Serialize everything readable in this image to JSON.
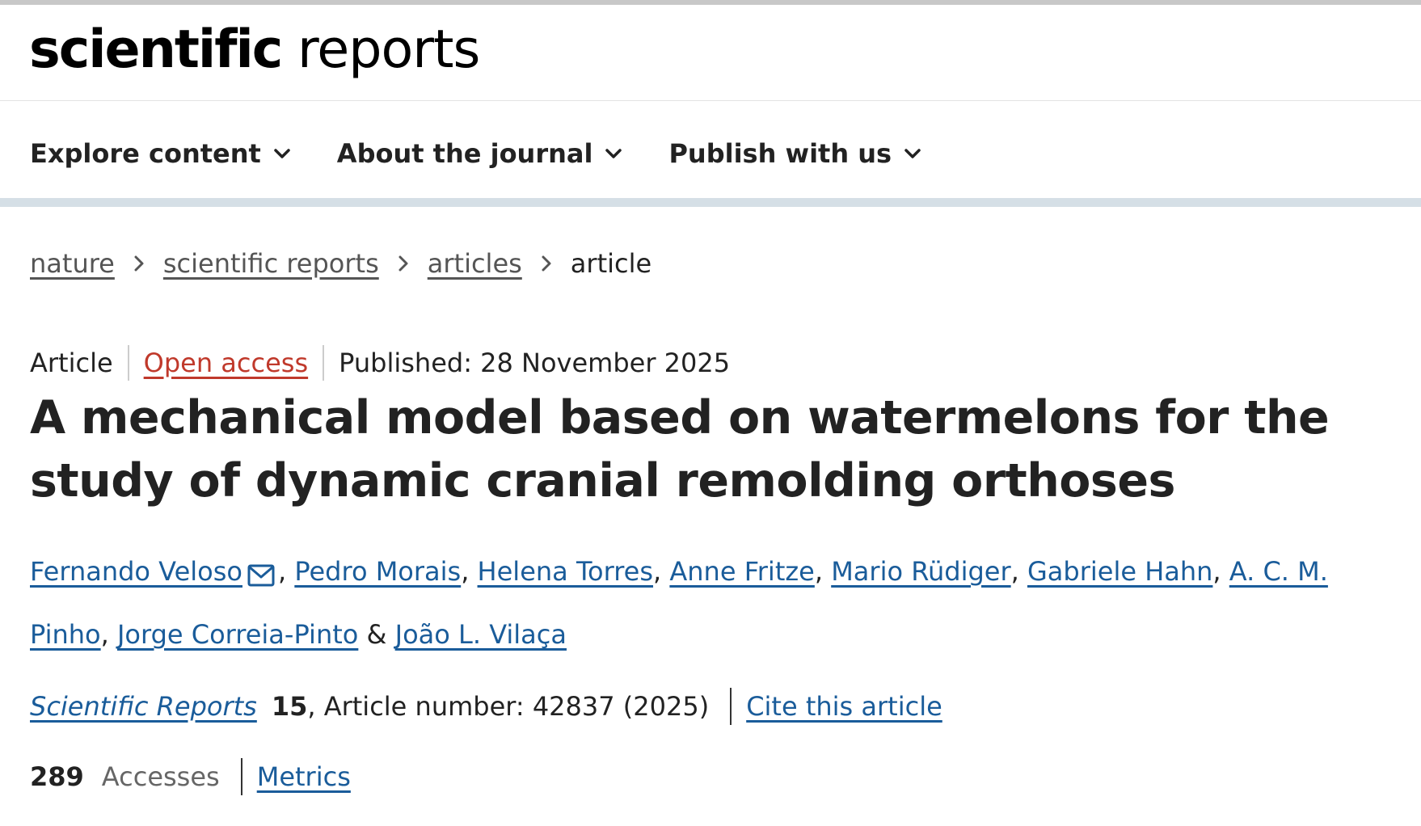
{
  "header": {
    "logo_bold": "scientific",
    "logo_regular": " reports"
  },
  "nav": {
    "items": [
      {
        "label": "Explore content"
      },
      {
        "label": "About the journal"
      },
      {
        "label": "Publish with us"
      }
    ]
  },
  "breadcrumb": {
    "items": [
      "nature",
      "scientific reports",
      "articles"
    ],
    "current": "article"
  },
  "article": {
    "type": "Article",
    "access": "Open access",
    "published": "Published: 28 November 2025",
    "title": "A mechanical model based on watermelons for the study of dynamic cranial remolding orthoses",
    "authors": [
      "Fernando Veloso",
      "Pedro Morais",
      "Helena Torres",
      "Anne Fritze",
      "Mario Rüdiger",
      "Gabriele Hahn",
      "A. C. M. Pinho",
      "Jorge Correia-Pinto",
      "João L. Vilaça"
    ],
    "author_sep": ", ",
    "author_and": " & "
  },
  "citation": {
    "journal": "Scientific Reports",
    "volume": "15",
    "article_number": ", Article number: 42837 (2025)",
    "cite_link": "Cite this article"
  },
  "metrics": {
    "accesses_count": "289",
    "accesses_label": "Accesses",
    "metrics_link": "Metrics"
  },
  "colors": {
    "link": "#1a5c9a",
    "open_access": "#c0392b",
    "nav_band": "#d5dfe6"
  }
}
